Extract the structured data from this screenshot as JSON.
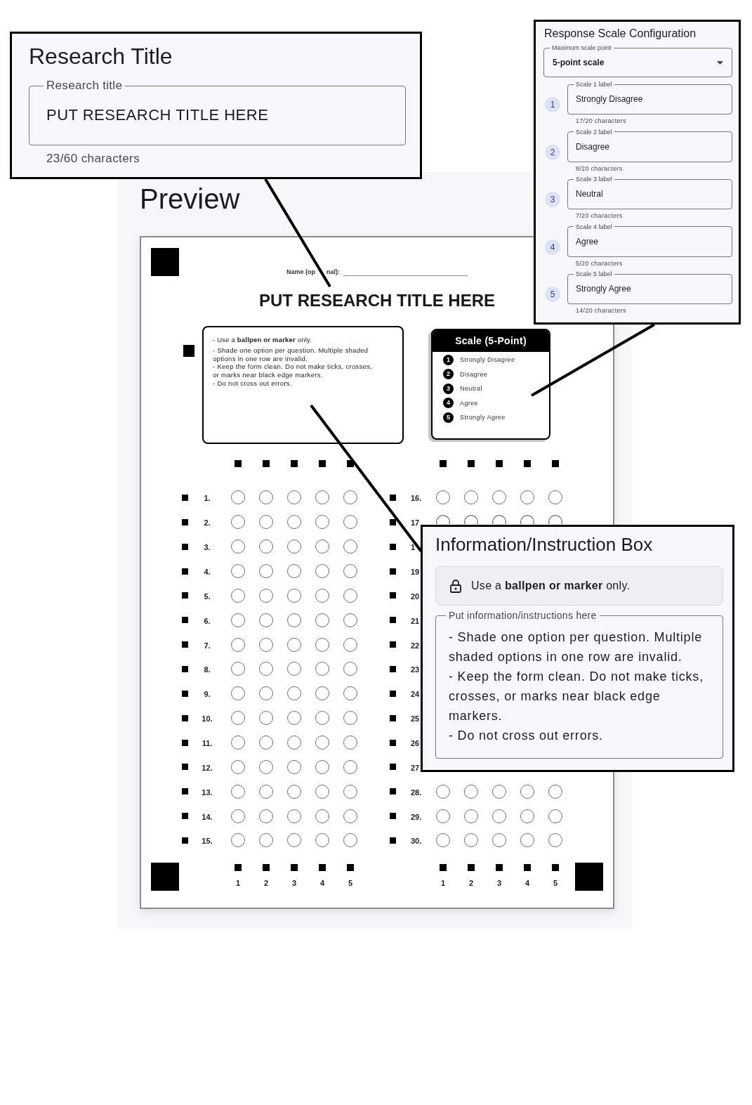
{
  "research_title_panel": {
    "title": "Research Title",
    "field": {
      "label": "Research title",
      "value": "PUT RESEARCH TITLE HERE"
    },
    "helper": "23/60 characters"
  },
  "scale_config_panel": {
    "title": "Response Scale Configuration",
    "select": {
      "label": "Maximum scale point",
      "value": "5-point scale"
    },
    "scale_fields": [
      {
        "number": "1",
        "label": "Scale 1 label",
        "value": "Strongly Disagree",
        "helper": "17/20 characters"
      },
      {
        "number": "2",
        "label": "Scale 2 label",
        "value": "Disagree",
        "helper": "8/20 characters"
      },
      {
        "number": "3",
        "label": "Scale 3 label",
        "value": "Neutral",
        "helper": "7/20 characters"
      },
      {
        "number": "4",
        "label": "Scale 4 label",
        "value": "Agree",
        "helper": "5/20 characters"
      },
      {
        "number": "5",
        "label": "Scale 5 label",
        "value": "Strongly Agree",
        "helper": "14/20 characters"
      }
    ]
  },
  "preview": {
    "heading": "Preview",
    "sheet": {
      "name_label_parts": [
        "Name (op",
        "nal):"
      ],
      "title": "PUT RESEARCH TITLE HERE",
      "instructions": {
        "first_line": "- Use a **ballpen or marker** only.",
        "text": "- Shade one option per question. Multiple shaded options in one row are invalid.\n- Keep the form clean. Do not make ticks, crosses, or marks near black edge markers.\n- Do not cross out errors."
      },
      "scale_box": {
        "title": "Scale (5-Point)",
        "items": [
          {
            "number": "1",
            "label": "Strongly Disagree"
          },
          {
            "number": "2",
            "label": "Disagree"
          },
          {
            "number": "3",
            "label": "Neutral"
          },
          {
            "number": "4",
            "label": "Agree"
          },
          {
            "number": "5",
            "label": "Strongly Agree"
          }
        ]
      },
      "answer_columns": [
        {
          "option_labels": [
            "1",
            "2",
            "3",
            "4",
            "5"
          ],
          "rows": [
            {
              "number": "1.",
              "kind": "full"
            },
            {
              "number": "2.",
              "kind": "full"
            },
            {
              "number": "3.",
              "kind": "full"
            },
            {
              "number": "4.",
              "kind": "full"
            },
            {
              "number": "5.",
              "kind": "full"
            },
            {
              "number": "6.",
              "kind": "full"
            },
            {
              "number": "7.",
              "kind": "full"
            },
            {
              "number": "8.",
              "kind": "full"
            },
            {
              "number": "9.",
              "kind": "full"
            },
            {
              "number": "10.",
              "kind": "full"
            },
            {
              "number": "11.",
              "kind": "full"
            },
            {
              "number": "12.",
              "kind": "full"
            },
            {
              "number": "13.",
              "kind": "full"
            },
            {
              "number": "14.",
              "kind": "full"
            },
            {
              "number": "15.",
              "kind": "full"
            }
          ]
        },
        {
          "option_labels": [
            "1",
            "2",
            "3",
            "4",
            "5"
          ],
          "rows": [
            {
              "number": "16.",
              "kind": "full"
            },
            {
              "number": "17",
              "kind": "cut"
            },
            {
              "number": "1",
              "kind": "number_only"
            },
            {
              "number": "19",
              "kind": "number_only"
            },
            {
              "number": "20",
              "kind": "number_only"
            },
            {
              "number": "21",
              "kind": "number_only"
            },
            {
              "number": "22",
              "kind": "number_only"
            },
            {
              "number": "23",
              "kind": "number_only"
            },
            {
              "number": "24",
              "kind": "number_only"
            },
            {
              "number": "25",
              "kind": "number_only"
            },
            {
              "number": "26",
              "kind": "number_only"
            },
            {
              "number": "27",
              "kind": "number_only"
            },
            {
              "number": "28.",
              "kind": "full"
            },
            {
              "number": "29.",
              "kind": "full"
            },
            {
              "number": "30.",
              "kind": "full"
            }
          ]
        }
      ]
    }
  },
  "instruction_panel": {
    "title": "Information/Instruction Box",
    "notice": "Use a **ballpen or marker** only.",
    "field": {
      "label": "Put information/instructions here",
      "value": "- Shade one option per question. Multiple shaded options in one row are invalid.\n- Keep the form clean. Do not make ticks, crosses, or marks near black edge markers.\n- Do not cross out errors."
    }
  }
}
